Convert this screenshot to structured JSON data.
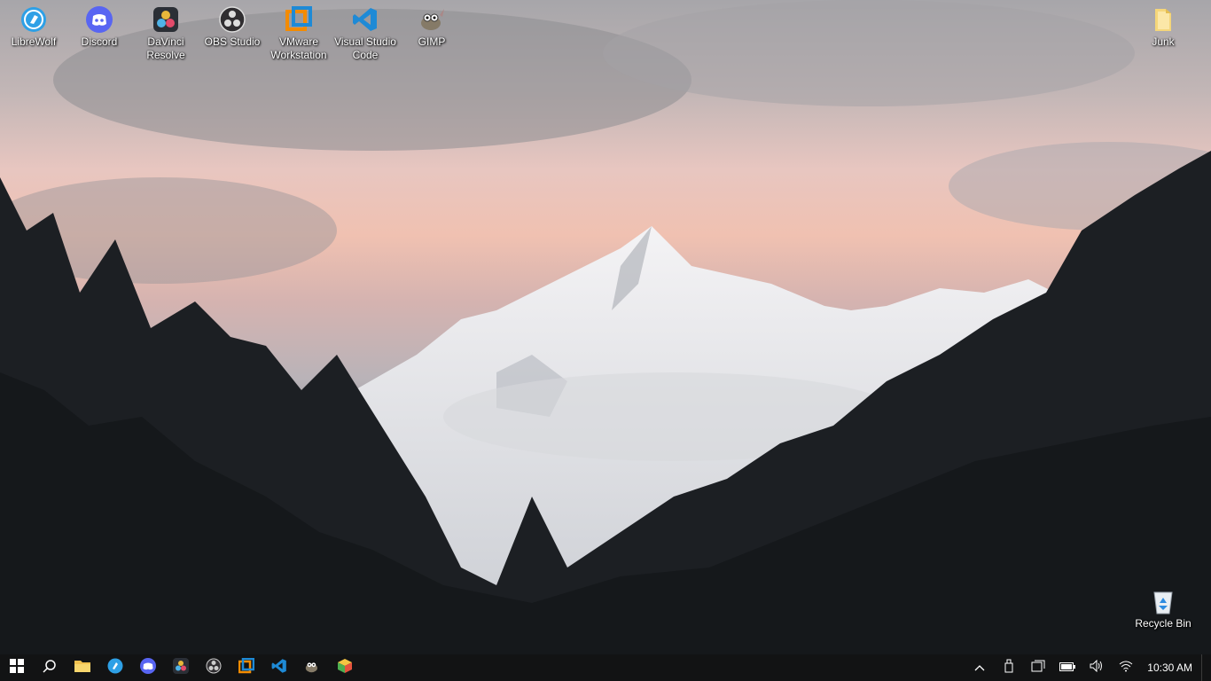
{
  "desktop_icons": [
    {
      "name": "librewolf",
      "label": "LibreWolf",
      "icon": "librewolf-icon"
    },
    {
      "name": "discord",
      "label": "Discord",
      "icon": "discord-icon"
    },
    {
      "name": "davinci-resolve",
      "label": "DaVinci Resolve",
      "icon": "davinci-resolve-icon"
    },
    {
      "name": "obs-studio",
      "label": "OBS Studio",
      "icon": "obs-icon"
    },
    {
      "name": "vmware-workstation",
      "label": "VMware Workstation",
      "icon": "vmware-icon"
    },
    {
      "name": "visual-studio-code",
      "label": "Visual Studio Code",
      "icon": "vscode-icon"
    },
    {
      "name": "gimp",
      "label": "GIMP",
      "icon": "gimp-icon"
    },
    {
      "name": "junk",
      "label": "Junk",
      "icon": "folder-icon"
    },
    {
      "name": "recycle-bin",
      "label": "Recycle Bin",
      "icon": "recycle-bin-icon"
    }
  ],
  "taskbar": {
    "start": "windows-start-icon",
    "search": "search-icon",
    "pinned": [
      "file-explorer-icon",
      "librewolf-icon",
      "discord-icon",
      "davinci-resolve-icon",
      "obs-icon",
      "vmware-icon",
      "vscode-icon",
      "gimp-icon",
      "app-cube-icon"
    ],
    "tray": [
      "chevron-up-icon",
      "usb-drive-icon",
      "task-view-icon",
      "battery-icon",
      "volume-icon",
      "wifi-icon"
    ],
    "clock": "10:30 AM"
  },
  "colors": {
    "taskbar": "#121314",
    "discord": "#5865f2",
    "vscode": "#1e8ad6",
    "vmware": "#f38b00",
    "librewolf": "#2ea0e6"
  }
}
